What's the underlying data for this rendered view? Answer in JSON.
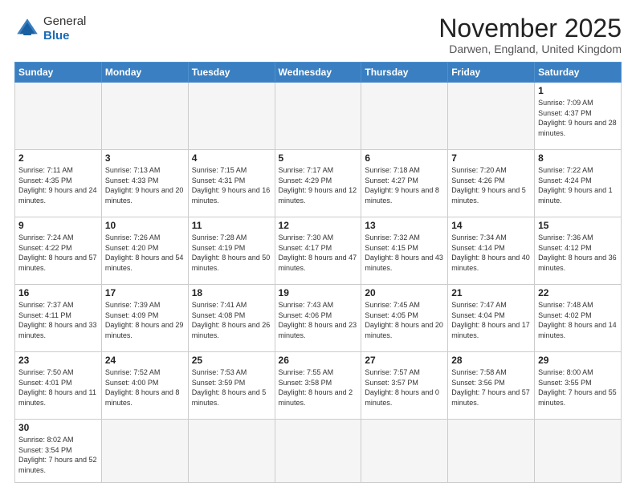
{
  "header": {
    "logo_general": "General",
    "logo_blue": "Blue",
    "month_title": "November 2025",
    "location": "Darwen, England, United Kingdom"
  },
  "days_of_week": [
    "Sunday",
    "Monday",
    "Tuesday",
    "Wednesday",
    "Thursday",
    "Friday",
    "Saturday"
  ],
  "weeks": [
    [
      {
        "day": "",
        "info": ""
      },
      {
        "day": "",
        "info": ""
      },
      {
        "day": "",
        "info": ""
      },
      {
        "day": "",
        "info": ""
      },
      {
        "day": "",
        "info": ""
      },
      {
        "day": "",
        "info": ""
      },
      {
        "day": "1",
        "info": "Sunrise: 7:09 AM\nSunset: 4:37 PM\nDaylight: 9 hours\nand 28 minutes."
      }
    ],
    [
      {
        "day": "2",
        "info": "Sunrise: 7:11 AM\nSunset: 4:35 PM\nDaylight: 9 hours\nand 24 minutes."
      },
      {
        "day": "3",
        "info": "Sunrise: 7:13 AM\nSunset: 4:33 PM\nDaylight: 9 hours\nand 20 minutes."
      },
      {
        "day": "4",
        "info": "Sunrise: 7:15 AM\nSunset: 4:31 PM\nDaylight: 9 hours\nand 16 minutes."
      },
      {
        "day": "5",
        "info": "Sunrise: 7:17 AM\nSunset: 4:29 PM\nDaylight: 9 hours\nand 12 minutes."
      },
      {
        "day": "6",
        "info": "Sunrise: 7:18 AM\nSunset: 4:27 PM\nDaylight: 9 hours\nand 8 minutes."
      },
      {
        "day": "7",
        "info": "Sunrise: 7:20 AM\nSunset: 4:26 PM\nDaylight: 9 hours\nand 5 minutes."
      },
      {
        "day": "8",
        "info": "Sunrise: 7:22 AM\nSunset: 4:24 PM\nDaylight: 9 hours\nand 1 minute."
      }
    ],
    [
      {
        "day": "9",
        "info": "Sunrise: 7:24 AM\nSunset: 4:22 PM\nDaylight: 8 hours\nand 57 minutes."
      },
      {
        "day": "10",
        "info": "Sunrise: 7:26 AM\nSunset: 4:20 PM\nDaylight: 8 hours\nand 54 minutes."
      },
      {
        "day": "11",
        "info": "Sunrise: 7:28 AM\nSunset: 4:19 PM\nDaylight: 8 hours\nand 50 minutes."
      },
      {
        "day": "12",
        "info": "Sunrise: 7:30 AM\nSunset: 4:17 PM\nDaylight: 8 hours\nand 47 minutes."
      },
      {
        "day": "13",
        "info": "Sunrise: 7:32 AM\nSunset: 4:15 PM\nDaylight: 8 hours\nand 43 minutes."
      },
      {
        "day": "14",
        "info": "Sunrise: 7:34 AM\nSunset: 4:14 PM\nDaylight: 8 hours\nand 40 minutes."
      },
      {
        "day": "15",
        "info": "Sunrise: 7:36 AM\nSunset: 4:12 PM\nDaylight: 8 hours\nand 36 minutes."
      }
    ],
    [
      {
        "day": "16",
        "info": "Sunrise: 7:37 AM\nSunset: 4:11 PM\nDaylight: 8 hours\nand 33 minutes."
      },
      {
        "day": "17",
        "info": "Sunrise: 7:39 AM\nSunset: 4:09 PM\nDaylight: 8 hours\nand 29 minutes."
      },
      {
        "day": "18",
        "info": "Sunrise: 7:41 AM\nSunset: 4:08 PM\nDaylight: 8 hours\nand 26 minutes."
      },
      {
        "day": "19",
        "info": "Sunrise: 7:43 AM\nSunset: 4:06 PM\nDaylight: 8 hours\nand 23 minutes."
      },
      {
        "day": "20",
        "info": "Sunrise: 7:45 AM\nSunset: 4:05 PM\nDaylight: 8 hours\nand 20 minutes."
      },
      {
        "day": "21",
        "info": "Sunrise: 7:47 AM\nSunset: 4:04 PM\nDaylight: 8 hours\nand 17 minutes."
      },
      {
        "day": "22",
        "info": "Sunrise: 7:48 AM\nSunset: 4:02 PM\nDaylight: 8 hours\nand 14 minutes."
      }
    ],
    [
      {
        "day": "23",
        "info": "Sunrise: 7:50 AM\nSunset: 4:01 PM\nDaylight: 8 hours\nand 11 minutes."
      },
      {
        "day": "24",
        "info": "Sunrise: 7:52 AM\nSunset: 4:00 PM\nDaylight: 8 hours\nand 8 minutes."
      },
      {
        "day": "25",
        "info": "Sunrise: 7:53 AM\nSunset: 3:59 PM\nDaylight: 8 hours\nand 5 minutes."
      },
      {
        "day": "26",
        "info": "Sunrise: 7:55 AM\nSunset: 3:58 PM\nDaylight: 8 hours\nand 2 minutes."
      },
      {
        "day": "27",
        "info": "Sunrise: 7:57 AM\nSunset: 3:57 PM\nDaylight: 8 hours\nand 0 minutes."
      },
      {
        "day": "28",
        "info": "Sunrise: 7:58 AM\nSunset: 3:56 PM\nDaylight: 7 hours\nand 57 minutes."
      },
      {
        "day": "29",
        "info": "Sunrise: 8:00 AM\nSunset: 3:55 PM\nDaylight: 7 hours\nand 55 minutes."
      }
    ],
    [
      {
        "day": "30",
        "info": "Sunrise: 8:02 AM\nSunset: 3:54 PM\nDaylight: 7 hours\nand 52 minutes."
      },
      {
        "day": "",
        "info": ""
      },
      {
        "day": "",
        "info": ""
      },
      {
        "day": "",
        "info": ""
      },
      {
        "day": "",
        "info": ""
      },
      {
        "day": "",
        "info": ""
      },
      {
        "day": "",
        "info": ""
      }
    ]
  ]
}
